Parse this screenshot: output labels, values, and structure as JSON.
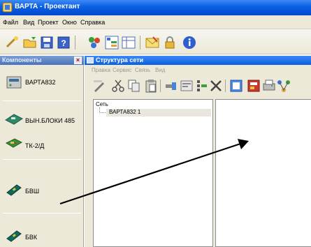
{
  "app": {
    "title": "ВАРТА - Проектант"
  },
  "menu": [
    "Файл",
    "Вид",
    "Проект",
    "Окно",
    "Справка"
  ],
  "toolbar_icons": [
    "wizard-icon",
    "open-folder-icon",
    "save-icon",
    "help-book-icon",
    "components-icon",
    "tree-icon",
    "table-icon",
    "mail-icon",
    "lock-icon",
    "info-icon"
  ],
  "left_panel": {
    "title": "Компоненты",
    "close_glyph": "×",
    "items": [
      {
        "label": "ВАРТА832",
        "icon": "device-icon"
      },
      {
        "label": "ВЫН.БЛОКИ 485",
        "icon": "module-icon"
      },
      {
        "label": "ТК-2/Д",
        "icon": "board-icon"
      },
      {
        "label": "БВШ",
        "icon": "cable-block-icon"
      },
      {
        "label": "БВК",
        "icon": "cable-block-icon"
      }
    ]
  },
  "network_window": {
    "title": "Структура сети",
    "menu": [
      "Правка",
      "Сервис",
      "Связь",
      "Вид"
    ],
    "toolbar_icons": [
      "edit-icon",
      "cut-icon",
      "copy-icon",
      "paste-icon",
      "insert-icon",
      "properties-icon",
      "grid-icon",
      "delete-icon",
      "frame-icon",
      "device-red-icon",
      "print-icon",
      "network-icon"
    ],
    "tree": {
      "root": "Сеть",
      "child": "ВАРТА832 1"
    }
  },
  "colors": {
    "titlebar": "#0a5fe0",
    "panel_bg": "#ece9d8",
    "arrow": "#000000"
  }
}
